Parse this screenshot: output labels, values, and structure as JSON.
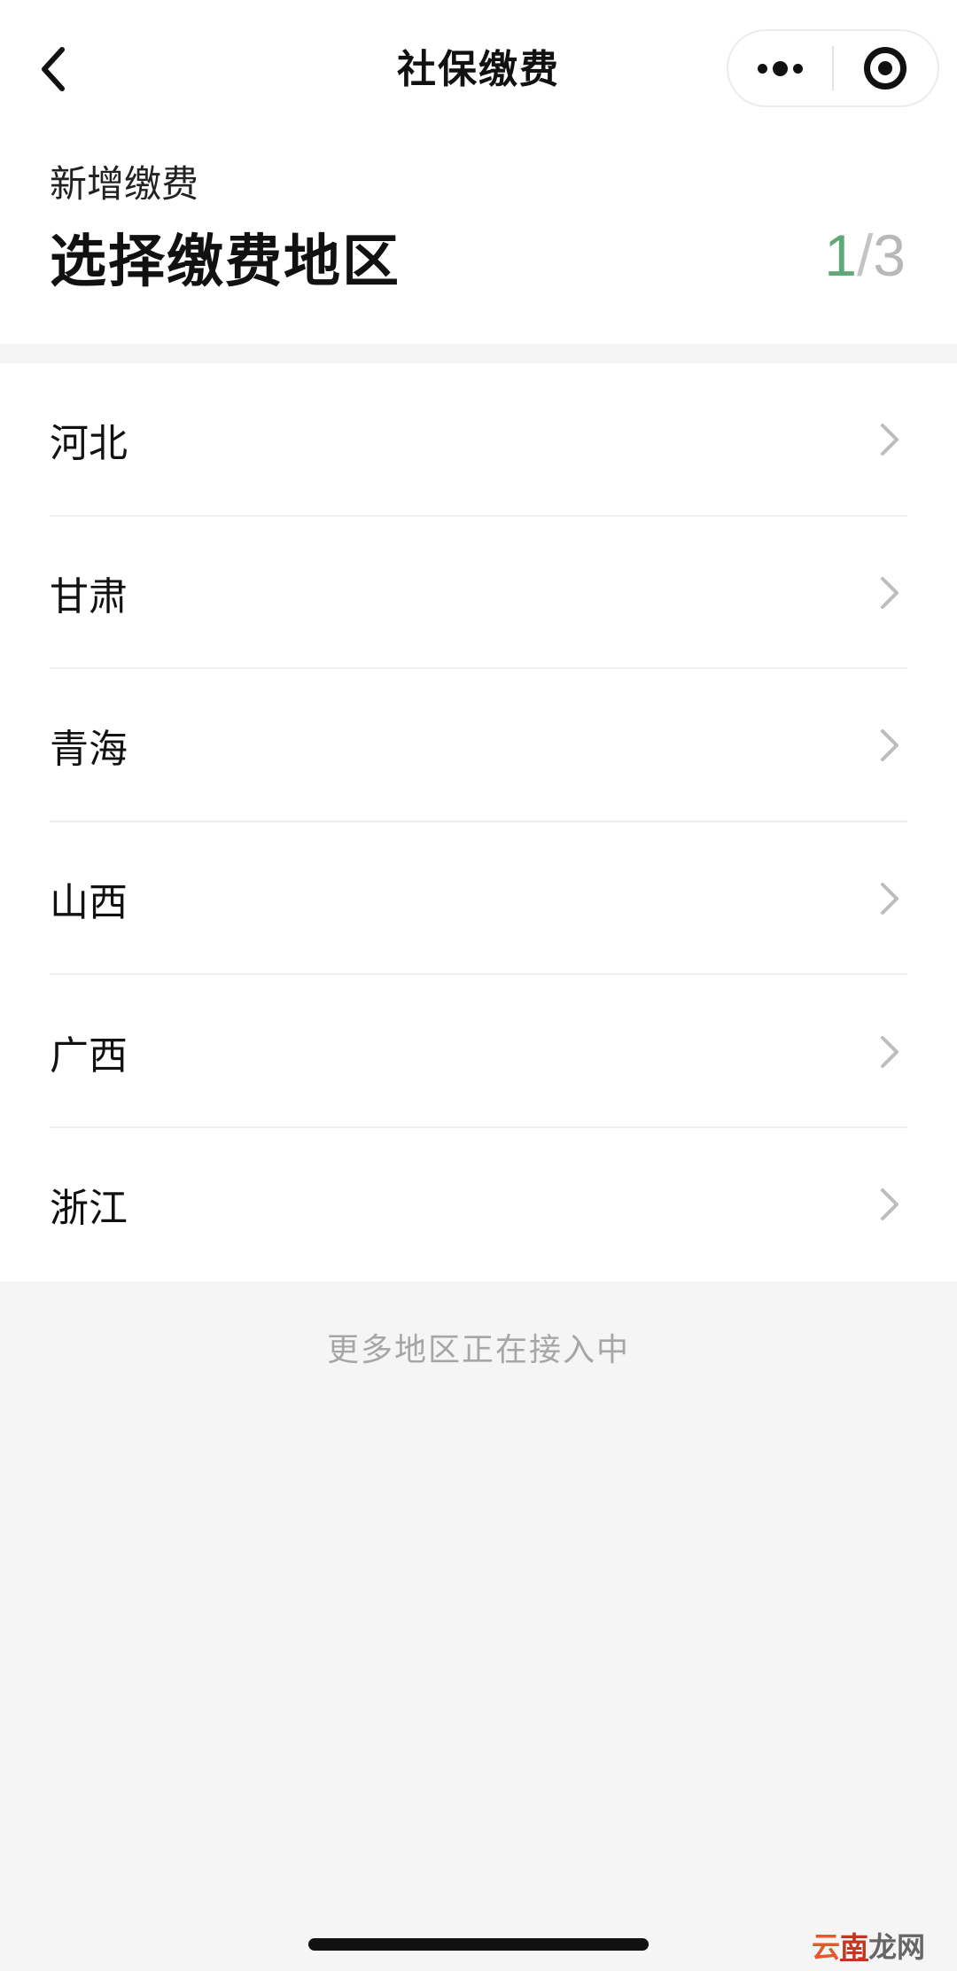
{
  "navbar": {
    "title": "社保缴费",
    "back_icon": "chevron-left-icon",
    "more_icon": "more-dots-icon",
    "close_icon": "target-circle-icon"
  },
  "header": {
    "subtitle": "新增缴费",
    "title": "选择缴费地区",
    "step_current": "1",
    "step_separator": "/",
    "step_total": "3"
  },
  "regions": [
    {
      "label": "河北"
    },
    {
      "label": "甘肃"
    },
    {
      "label": "青海"
    },
    {
      "label": "山西"
    },
    {
      "label": "广西"
    },
    {
      "label": "浙江"
    }
  ],
  "footer_note": "更多地区正在接入中",
  "watermark": {
    "part1": "云",
    "part2": "南",
    "part3": "龙网"
  },
  "colors": {
    "accent_green": "#5fa879",
    "background": "#f5f5f5",
    "muted_text": "#a6a6a6"
  }
}
